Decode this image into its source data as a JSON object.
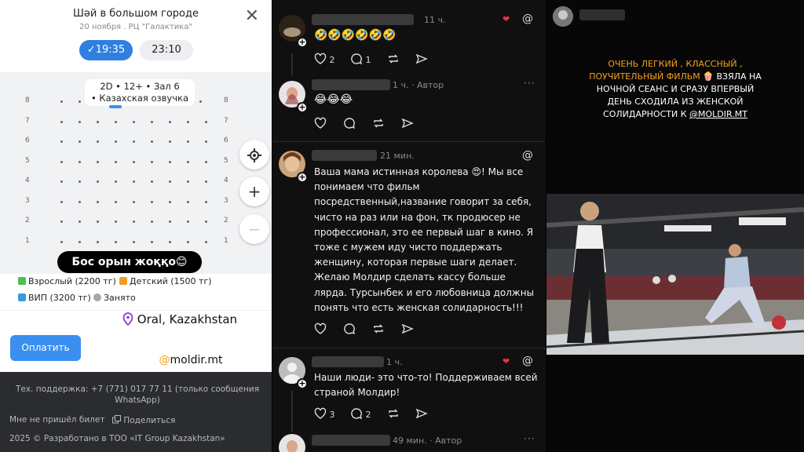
{
  "booking": {
    "title": "Шәй в большом городе",
    "subtitle": "20 ноября . РЦ \"Галактика\"",
    "times": [
      "✓19:35",
      "23:10"
    ],
    "hall_line1": "2D • 12+ • Зал 6",
    "hall_line2": "• Казахская озвучка",
    "rows": [
      "8",
      "7",
      "6",
      "5",
      "4",
      "3",
      "2",
      "1"
    ],
    "overlay": "Бос орын жоққо😊",
    "legend": {
      "adult": "Взрослый (2200 тг)",
      "child": "Детский (1500 тг)",
      "vip": "ВИП (3200 тг)",
      "taken": "Занято"
    },
    "location": "Oral, Kazakhstan",
    "pay_button": "Оплатить",
    "username_tag": "@moldir.mt",
    "support": "Тех. поддержка: +7 (771) 017 77 11 (только сообщения WhatsApp)",
    "not_came": "Мне не пришёл билет",
    "share": "Поделиться",
    "copyright": "2025 © Разработано в ТОО «IT Group Kazakhstan»",
    "colors": {
      "adult": "#4cc14c",
      "child": "#f39a2b",
      "vip": "#3a9ad9",
      "taken": "#a7a7a7",
      "primary": "#3a8ff0"
    }
  },
  "threads": {
    "posts": [
      {
        "time": "11 ч.",
        "text": "🤣🤣🤣🤣🤣🤣",
        "likes": "2",
        "replies": "1"
      },
      {
        "time": "1 ч. · Автор",
        "text": "😂😂😂"
      },
      {
        "time": "21 мин.",
        "text": "Ваша мама истинная королева 😍! Мы все понимаем что фильм посредственный,название говорит за себя, чисто на раз или на фон, тк продюсер не профессионал, это ее первый шаг в кино. Я тоже с мужем иду чисто поддержать женщину, которая первые шаги делает. Желаю Молдир сделать кассу больше лярда. Турсынбек и его любовница должны понять что есть женская солидарность!!!"
      },
      {
        "time": "1 ч.",
        "text": "Наши люди- это что-то! Поддерживаем всей страной Молдир!",
        "likes": "3",
        "replies": "2"
      },
      {
        "time": "49 мин. · Автор"
      }
    ]
  },
  "story": {
    "caption_yellow": "Очень легкий , классный , поучительный фильм 🍿",
    "caption_white": " взяла на ночной сеанс и сразу впервый день сходила из женской солидарности к ",
    "caption_mention": "@moldir.mt"
  }
}
